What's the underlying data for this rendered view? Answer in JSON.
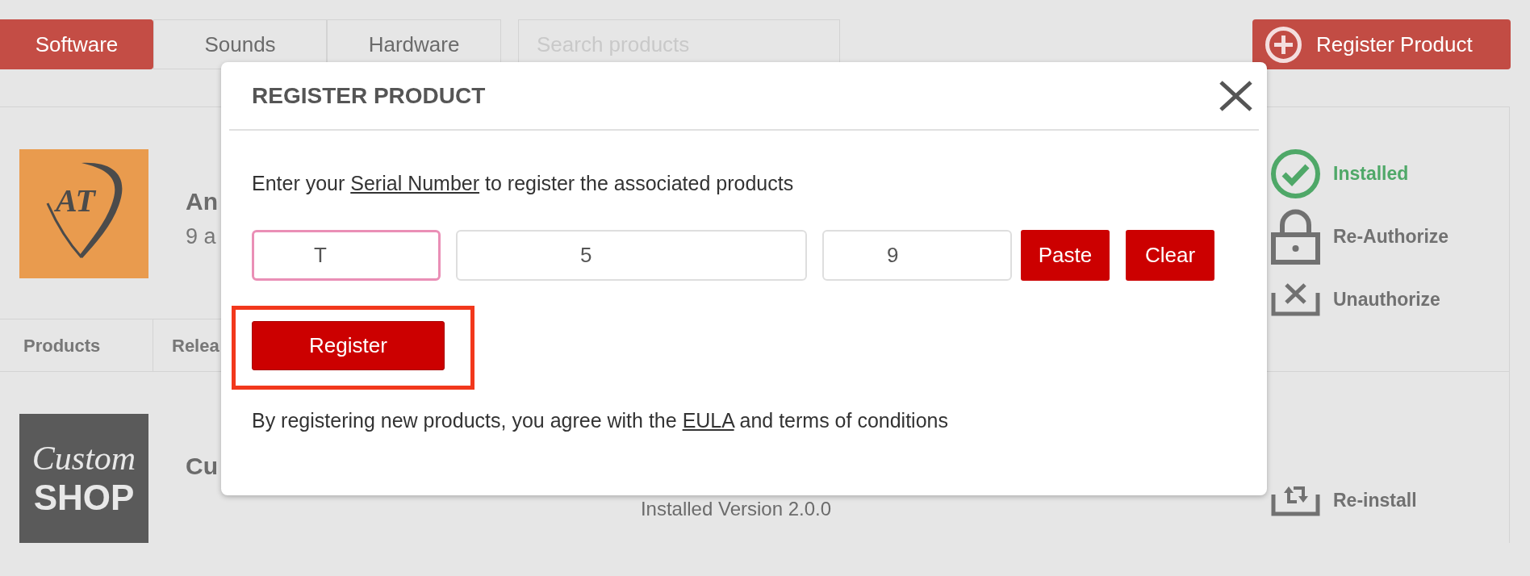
{
  "tabs": [
    {
      "label": "Software",
      "selected": true
    },
    {
      "label": "Sounds",
      "selected": false
    },
    {
      "label": "Hardware",
      "selected": false
    }
  ],
  "search": {
    "placeholder": "Search products"
  },
  "register_product_button": {
    "label": "Register Product"
  },
  "products": [
    {
      "logo": {
        "kind": "pick",
        "lines": [
          "AT"
        ]
      },
      "title": "An",
      "subtitle": "9 a",
      "sections": [
        "Products",
        "Relea"
      ],
      "actions": [
        {
          "kind": "installed",
          "label": "Installed"
        },
        {
          "kind": "reauthorize",
          "label": "Re-Authorize"
        },
        {
          "kind": "unauthorize",
          "label": "Unauthorize"
        }
      ]
    },
    {
      "logo": {
        "kind": "wordmark",
        "lines": [
          "Custom",
          "SHOP"
        ]
      },
      "title": "Cu",
      "version": "Installed Version 2.0.0",
      "actions": [
        {
          "kind": "reinstall",
          "label": "Re-install"
        }
      ]
    }
  ],
  "dialog": {
    "title": "REGISTER PRODUCT",
    "instruction": {
      "before": "Enter your ",
      "link": "Serial Number",
      "after": " to register the associated products"
    },
    "serial_fields": [
      {
        "value": "T",
        "focused": true
      },
      {
        "value": "5",
        "focused": false
      },
      {
        "value": "9",
        "focused": false
      }
    ],
    "buttons": [
      "Paste",
      "Clear"
    ],
    "register_button": {
      "label": "Register",
      "highlighted": true
    },
    "agreement": {
      "before": "By registering new products, you agree with the ",
      "link": "EULA",
      "after": " and terms of conditions"
    }
  }
}
